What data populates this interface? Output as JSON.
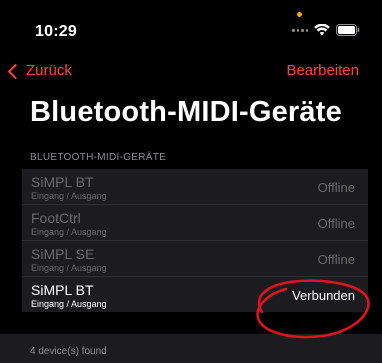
{
  "status_bar": {
    "time": "10:29",
    "icons": [
      "dots-icon",
      "wifi-icon",
      "battery-icon"
    ],
    "indicator_color": "#ff9f0a"
  },
  "nav": {
    "back_label": "Zurück",
    "edit_label": "Bearbeiten",
    "accent_color": "#ff453a"
  },
  "title": "Bluetooth-MIDI-Geräte",
  "section_header": "BLUETOOTH-MIDI-GERÄTE",
  "devices": [
    {
      "name": "SiMPL BT",
      "subtitle": "Eingang / Ausgang",
      "status": "Offline"
    },
    {
      "name": "FootCtrl",
      "subtitle": "Eingang / Ausgang",
      "status": "Offline"
    },
    {
      "name": "SiMPL SE",
      "subtitle": "Eingang / Ausgang",
      "status": "Offline"
    },
    {
      "name": "SiMPL BT",
      "subtitle": "Eingang / Ausgang",
      "status": "Verbunden"
    }
  ],
  "footer": "4 device(s) found",
  "annotation_color": "#e0141e"
}
